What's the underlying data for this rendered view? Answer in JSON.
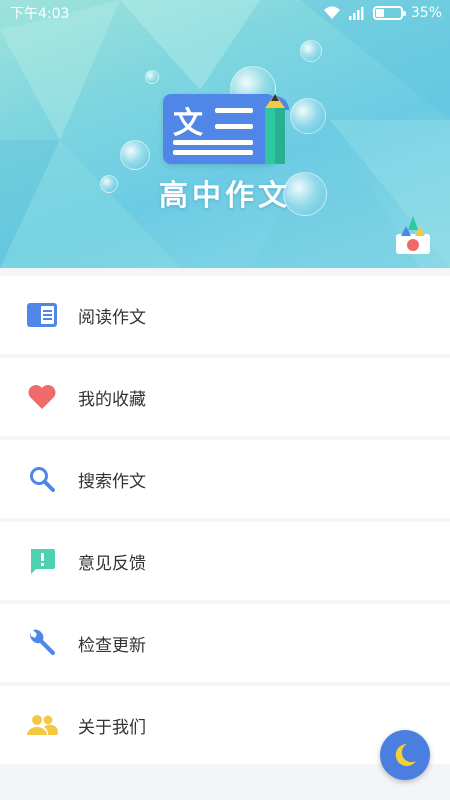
{
  "status_bar": {
    "time": "下午4:03",
    "battery_percent": "35%",
    "battery_level": 0.35
  },
  "header": {
    "logo_text": "文",
    "app_title": "高中作文"
  },
  "menu": {
    "items": [
      {
        "label": "阅读作文",
        "icon": "book-icon",
        "color": "#4f86e8"
      },
      {
        "label": "我的收藏",
        "icon": "heart-icon",
        "color": "#f06a6a"
      },
      {
        "label": "搜索作文",
        "icon": "search-icon",
        "color": "#4f86e8"
      },
      {
        "label": "意见反馈",
        "icon": "feedback-icon",
        "color": "#4fd0b0"
      },
      {
        "label": "检查更新",
        "icon": "wrench-icon",
        "color": "#4f86e8"
      },
      {
        "label": "关于我们",
        "icon": "people-icon",
        "color": "#f5c842"
      }
    ]
  },
  "night_mode": {
    "icon": "moon-icon"
  }
}
